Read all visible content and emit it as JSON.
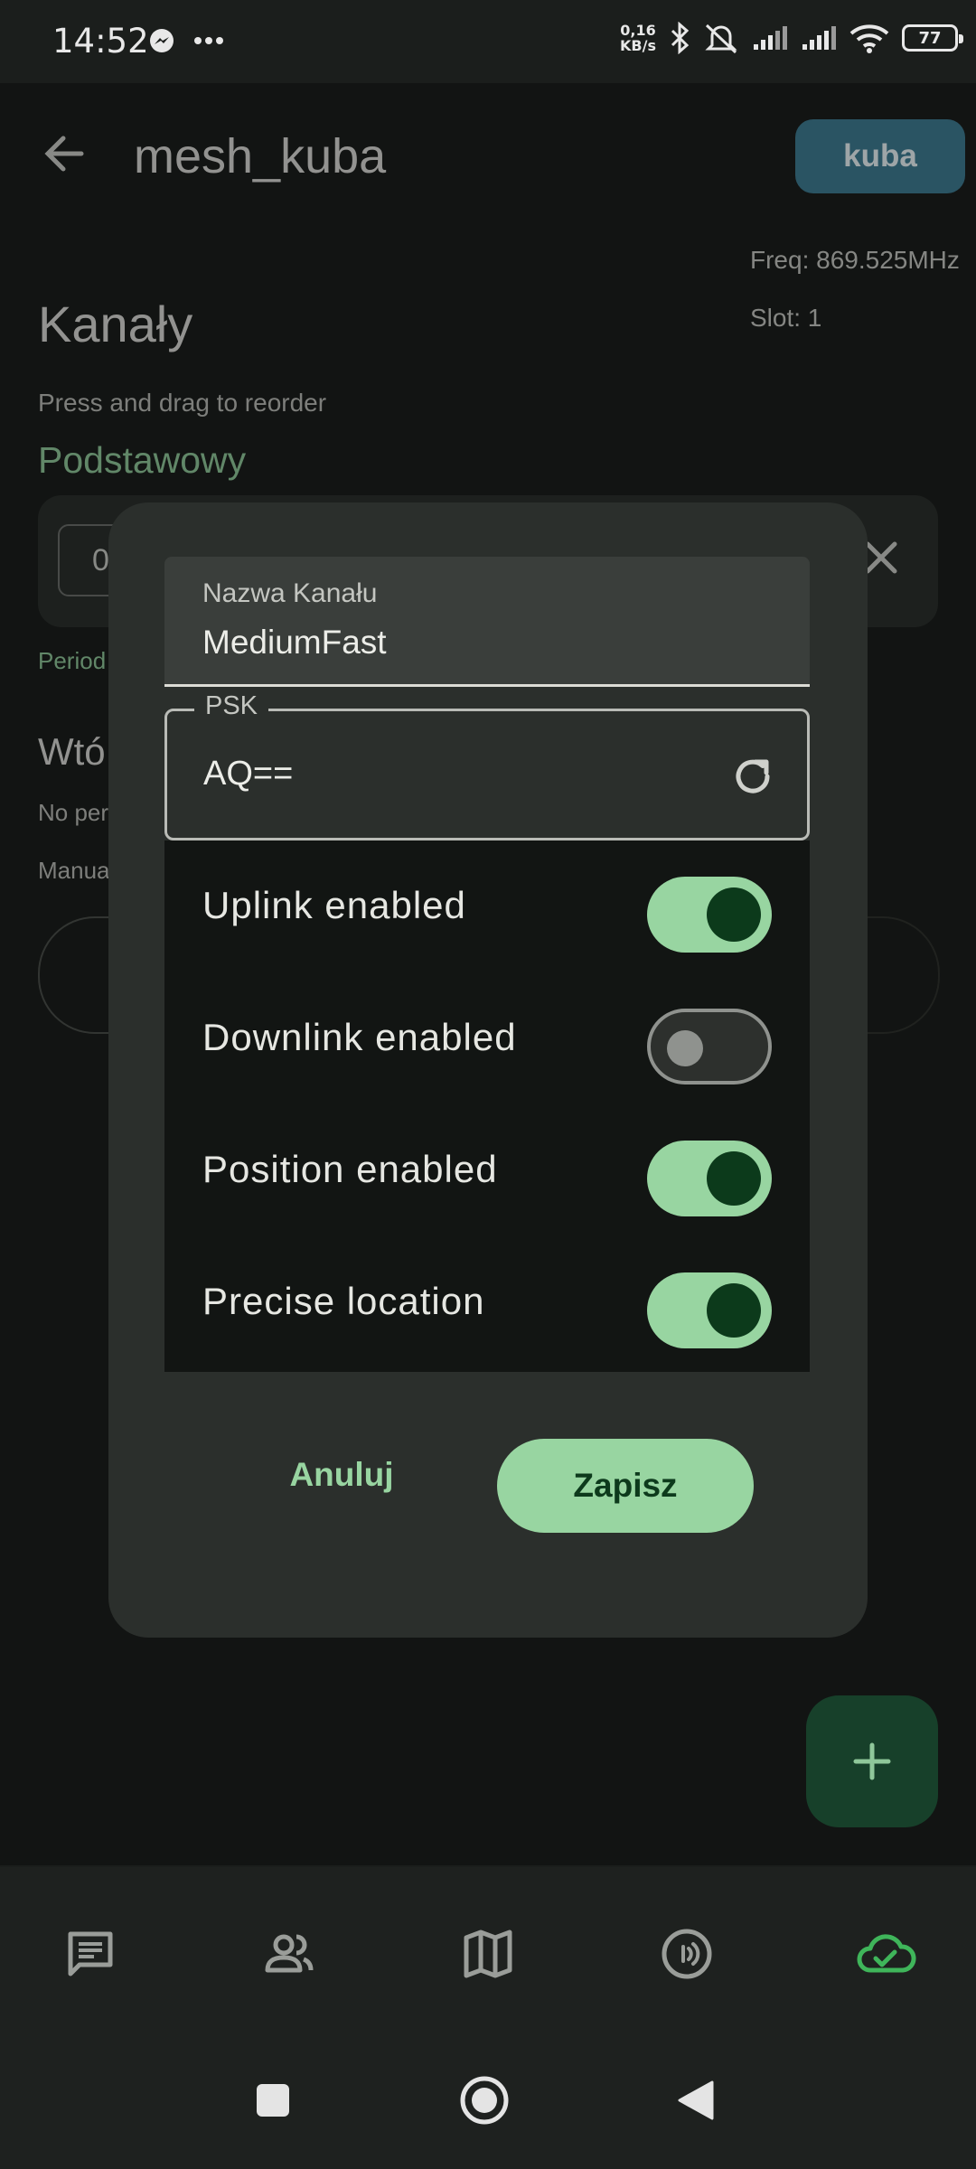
{
  "status_bar": {
    "time": "14:52",
    "speed_value": "0,16",
    "speed_unit": "KB/s",
    "battery": "77",
    "icons": [
      "messenger-icon",
      "more-dots-icon",
      "bluetooth-icon",
      "silent-icon",
      "signal-icon",
      "signal-icon",
      "wifi-icon",
      "battery-icon"
    ]
  },
  "header": {
    "title": "mesh_kuba",
    "node_chip": "kuba",
    "frequency": "Freq: 869.525MHz",
    "slot": "Slot: 1"
  },
  "background": {
    "heading": "Kanały",
    "hint": "Press and drag to reorder",
    "primary_label": "Podstawowy",
    "channel_index": "0",
    "periodic_text": "Period",
    "secondary_label": "Wtó",
    "no_permission": "No per",
    "manual": "Manua"
  },
  "dialog": {
    "name_label": "Nazwa Kanału",
    "name_value": "MediumFast",
    "psk_label": "PSK",
    "psk_value": "AQ==",
    "toggles": [
      {
        "label": "Uplink enabled",
        "on": true
      },
      {
        "label": "Downlink enabled",
        "on": false
      },
      {
        "label": "Position enabled",
        "on": true
      },
      {
        "label": "Precise location",
        "on": true
      }
    ],
    "cancel_label": "Anuluj",
    "save_label": "Zapisz"
  },
  "bottom_nav": {
    "items": [
      {
        "icon": "messages-icon",
        "active": false
      },
      {
        "icon": "contacts-icon",
        "active": false
      },
      {
        "icon": "map-icon",
        "active": false
      },
      {
        "icon": "radio-config-icon",
        "active": false
      },
      {
        "icon": "cloud-connected-icon",
        "active": true
      }
    ]
  },
  "colors": {
    "accent_green": "#98d5a1",
    "chip_blue": "#3f7d93",
    "dialog_bg": "#2b2f2c",
    "page_bg": "#1b1e1c"
  }
}
